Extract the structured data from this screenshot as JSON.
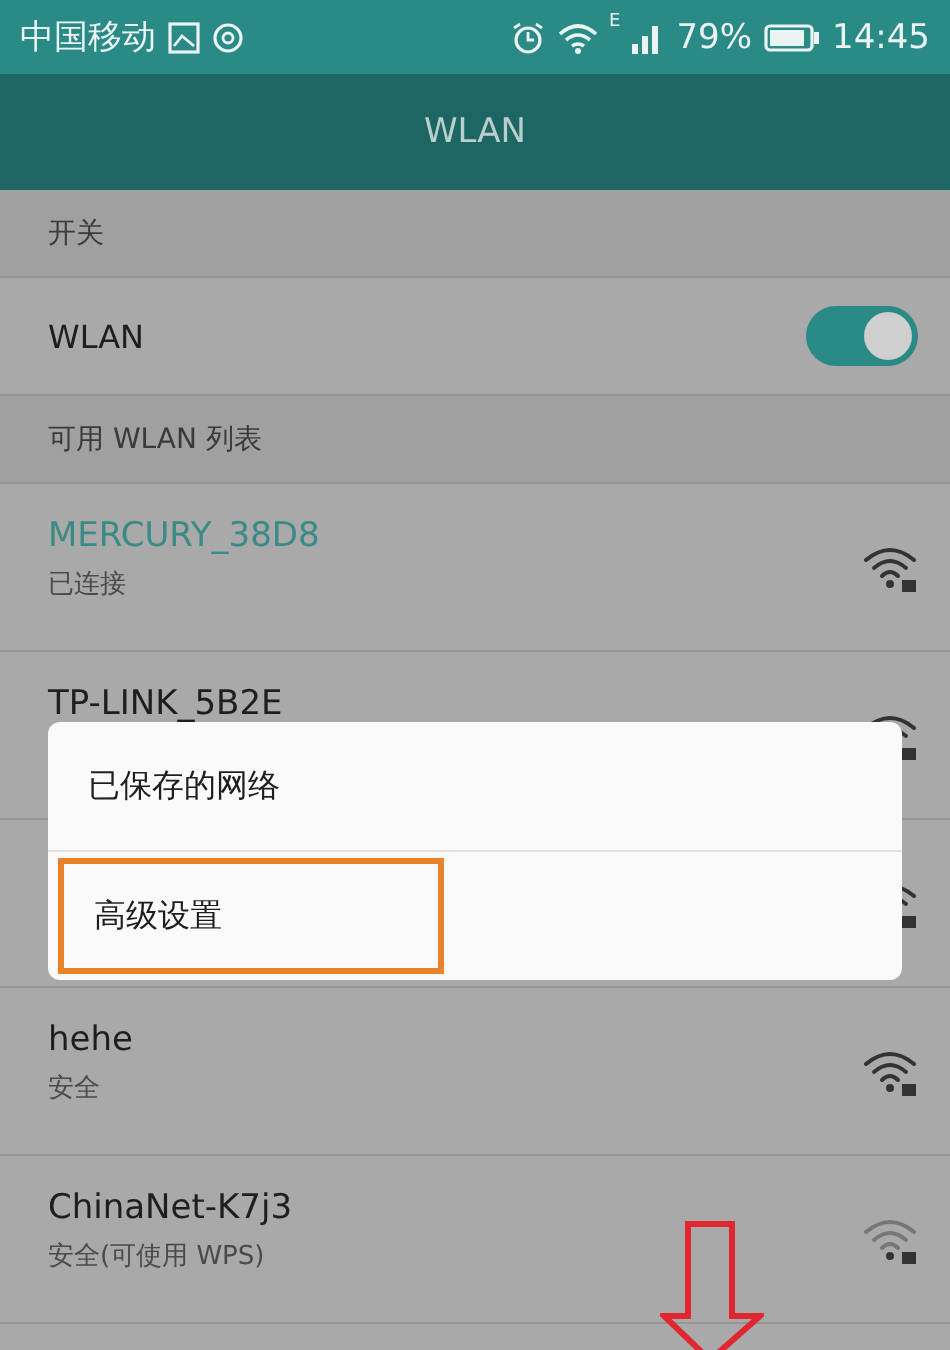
{
  "status_bar": {
    "carrier": "中国移动",
    "network_type": "E",
    "battery": "79%",
    "time": "14:45"
  },
  "title_bar": {
    "title": "WLAN"
  },
  "switch_section": {
    "header": "开关",
    "label": "WLAN",
    "on": true
  },
  "network_section": {
    "header": "可用 WLAN 列表"
  },
  "networks": [
    {
      "kind": "network",
      "name": "MERCURY_38D8",
      "status": "已连接",
      "connected": true
    },
    {
      "kind": "network",
      "name": "TP-LINK_5B2E",
      "connected": false
    },
    {
      "kind": "covered"
    },
    {
      "kind": "network",
      "name": "hehe",
      "status": "安全",
      "connected": false
    },
    {
      "kind": "network",
      "name": "ChinaNet-K7j3",
      "status": "安全(可使用 WPS)",
      "connected": false
    }
  ],
  "menu": {
    "items": [
      {
        "label": "已保存的网络",
        "highlighted": false
      },
      {
        "label": "高级设置",
        "highlighted": true
      }
    ]
  },
  "annotation": {
    "kind": "down-arrow"
  }
}
